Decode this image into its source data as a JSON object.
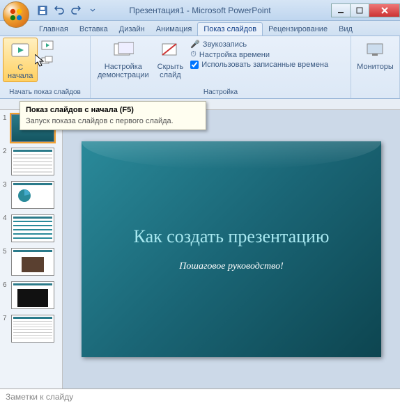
{
  "window": {
    "title": "Презентация1 - Microsoft PowerPoint"
  },
  "tabs": {
    "home": "Главная",
    "insert": "Вставка",
    "design": "Дизайн",
    "animation": "Анимация",
    "slideshow": "Показ слайдов",
    "review": "Рецензирование",
    "view": "Вид"
  },
  "ribbon": {
    "start": {
      "from_begin": "С\nначала",
      "group_label": "Начать показ слайдов"
    },
    "setup": {
      "setup_show": "Настройка\nдемонстрации",
      "hide_slide": "Скрыть\nслайд",
      "record": "Звукозапись",
      "rehearse": "Настройка времени",
      "use_timings": "Использовать записанные времена",
      "group_label": "Настройка"
    },
    "monitors": {
      "label": "Мониторы"
    }
  },
  "tooltip": {
    "title": "Показ слайдов с начала (F5)",
    "body": "Запуск показа слайдов с первого слайда."
  },
  "thumbnails": [
    {
      "num": "1",
      "type": "teal"
    },
    {
      "num": "2",
      "type": "white"
    },
    {
      "num": "3",
      "type": "chart"
    },
    {
      "num": "4",
      "type": "list"
    },
    {
      "num": "5",
      "type": "photo"
    },
    {
      "num": "6",
      "type": "dark"
    },
    {
      "num": "7",
      "type": "text"
    }
  ],
  "slide": {
    "title": "Как создать презентацию",
    "subtitle": "Пошаговое руководство!"
  },
  "notes": {
    "placeholder": "Заметки к слайду"
  }
}
